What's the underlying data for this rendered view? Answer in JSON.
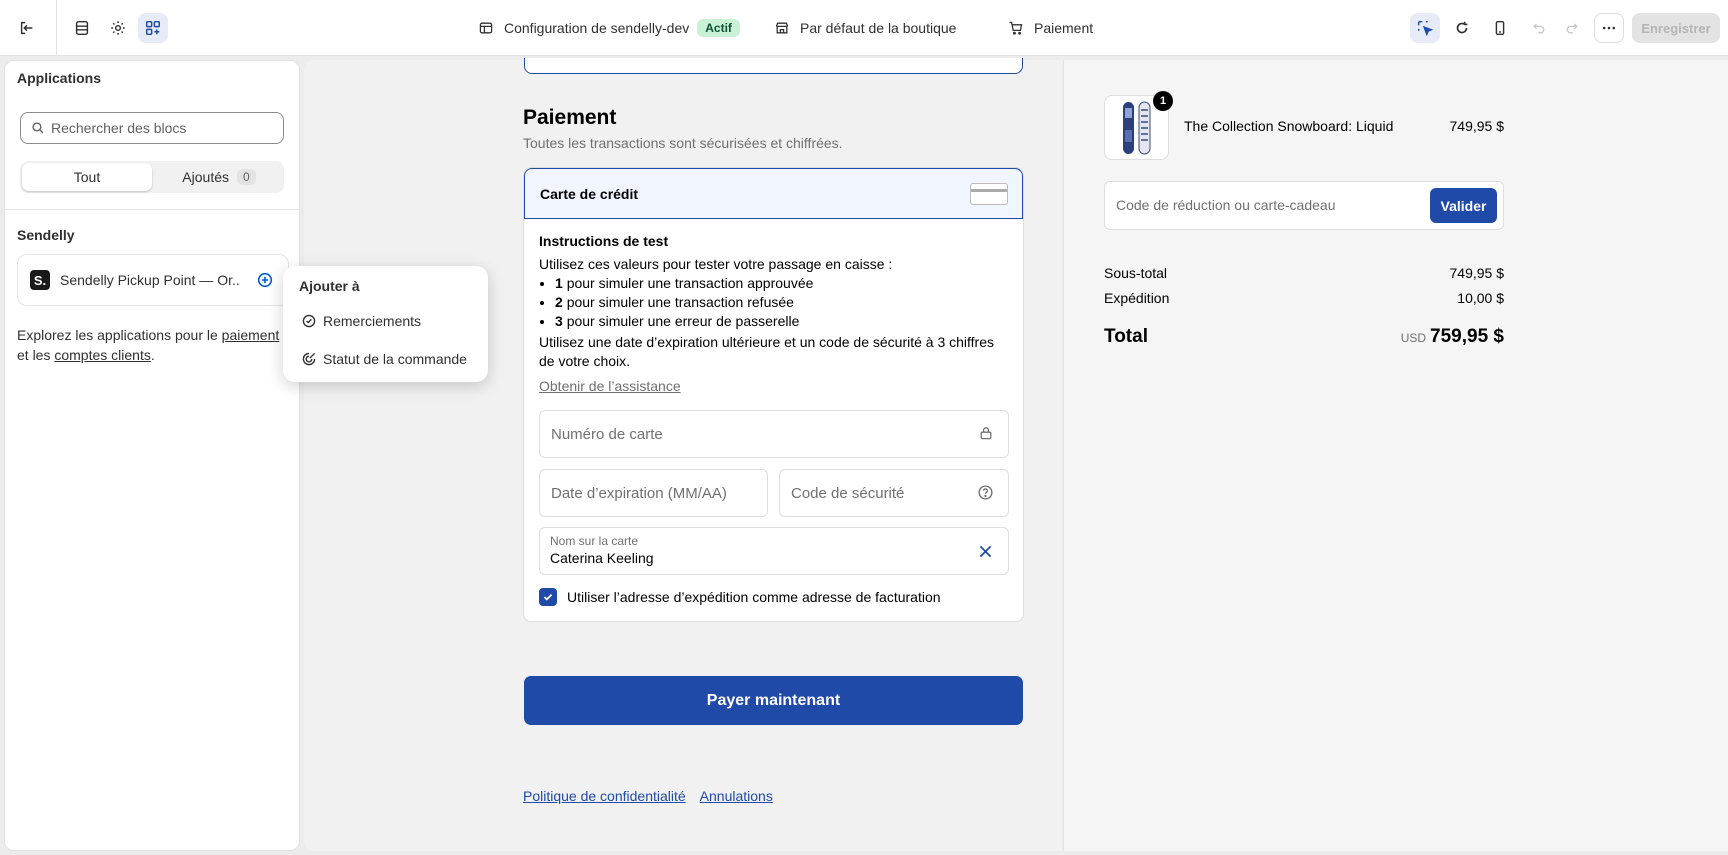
{
  "topbar": {
    "store_label": "Configuration de sendelly-dev",
    "status_badge": "Actif",
    "profile_label": "Par défaut de la boutique",
    "page_label": "Paiement",
    "save_label": "Enregistrer"
  },
  "sidebar": {
    "title": "Applications",
    "search_placeholder": "Rechercher des blocs",
    "tabs": [
      {
        "label": "Tout"
      },
      {
        "label": "Ajoutés",
        "count": "0"
      }
    ],
    "section_title": "Sendelly",
    "app": {
      "logo": "S.",
      "name": "Sendelly Pickup Point — Or..."
    },
    "explore": {
      "prefix": "Explorez les applications pour le",
      "link1": "paiement",
      "middle": "et les",
      "link2": "comptes clients",
      "suffix": "."
    }
  },
  "popover": {
    "title": "Ajouter à",
    "items": [
      {
        "label": "Remerciements",
        "icon": "check-circle-icon"
      },
      {
        "label": "Statut de la commande",
        "icon": "order-status-icon"
      }
    ]
  },
  "checkout": {
    "payment_heading": "Paiement",
    "payment_subtitle": "Toutes les transactions sont sécurisées et chiffrées.",
    "method_label": "Carte de crédit",
    "test_title": "Instructions de test",
    "test_intro": "Utilisez ces valeurs pour tester votre passage en caisse :",
    "test_items": [
      {
        "num": "1",
        "text": "pour simuler une transaction approuvée"
      },
      {
        "num": "2",
        "text": "pour simuler une transaction refusée"
      },
      {
        "num": "3",
        "text": "pour simuler une erreur de passerelle"
      }
    ],
    "test_note": "Utilisez une date d’expiration ultérieure et un code de sécurité à 3 chiffres de votre choix.",
    "help_link": "Obtenir de l’assistance",
    "card_number_placeholder": "Numéro de carte",
    "expiry_placeholder": "Date d’expiration (MM/AA)",
    "cvv_placeholder": "Code de sécurité",
    "name_label": "Nom sur la carte",
    "name_value": "Caterina Keeling",
    "billing_checkbox_label": "Utiliser l’adresse d’expédition comme adresse de facturation",
    "billing_checked": true,
    "pay_button": "Payer maintenant",
    "footer_links": [
      "Politique de confidentialité",
      "Annulations"
    ]
  },
  "summary": {
    "product_name": "The Collection Snowboard: Liquid",
    "product_price": "749,95 $",
    "product_qty": "1",
    "discount_placeholder": "Code de réduction ou carte-cadeau",
    "discount_button": "Valider",
    "subtotal_label": "Sous-total",
    "subtotal_value": "749,95 $",
    "shipping_label": "Expédition",
    "shipping_value": "10,00 $",
    "total_label": "Total",
    "total_currency": "USD",
    "total_value": "759,95 $"
  },
  "colors": {
    "accent": "#1f4aa8",
    "badge_bg": "#c9f2d5",
    "admin_blue": "#005bd3"
  }
}
